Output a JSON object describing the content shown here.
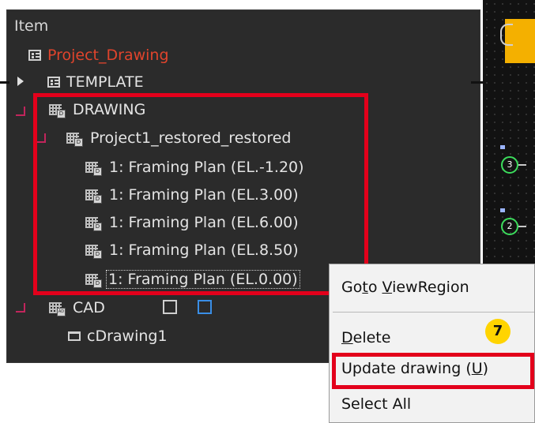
{
  "tree": {
    "header": "Item",
    "project": "Project_Drawing",
    "template": "TEMPLATE",
    "drawing": "DRAWING",
    "project_child": "Project1_restored_restored",
    "plans": [
      "1: Framing Plan (EL.-1.20)",
      "1: Framing Plan (EL.3.00)",
      "1: Framing Plan (EL.6.00)",
      "1: Framing Plan (EL.8.50)",
      "1: Framing Plan (EL.0.00)"
    ],
    "cad": "CAD",
    "cad_child": "cDrawing1"
  },
  "canvas": {
    "nodes": [
      "3",
      "2"
    ]
  },
  "context_menu": {
    "goto": {
      "pre": "Go",
      "hotkey": "t",
      "mid": "o ",
      "hotkey2": "V",
      "post": "iewRegion"
    },
    "delete": {
      "hotkey": "D",
      "post": "elete"
    },
    "update": {
      "pre": "Update drawing (",
      "hotkey": "U",
      "post": ")"
    },
    "select_all": "Select All"
  },
  "annotation": {
    "step": "7"
  },
  "colors": {
    "highlight_red": "#e3001b",
    "badge_yellow": "#ffd400",
    "project_text": "#e0442c",
    "node_green": "#3cdc5c"
  }
}
